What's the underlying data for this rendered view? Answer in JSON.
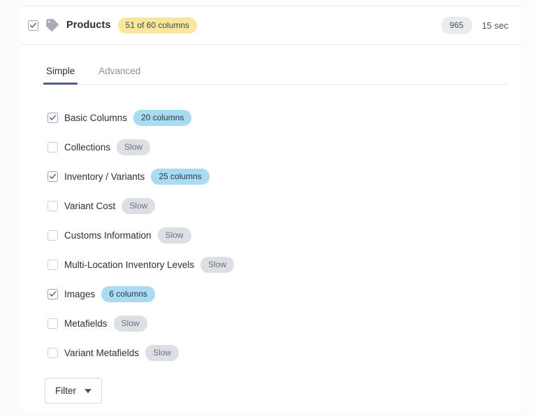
{
  "header": {
    "checkbox_checked": true,
    "icon": "tag-icon",
    "title": "Products",
    "columns_badge": "51 of 60 columns",
    "count_badge": "965",
    "duration": "15 sec"
  },
  "tabs": [
    {
      "label": "Simple",
      "active": true
    },
    {
      "label": "Advanced",
      "active": false
    }
  ],
  "options": [
    {
      "label": "Basic Columns",
      "checked": true,
      "badge": "20 columns",
      "badge_type": "blue"
    },
    {
      "label": "Collections",
      "checked": false,
      "badge": "Slow",
      "badge_type": "gray"
    },
    {
      "label": "Inventory / Variants",
      "checked": true,
      "badge": "25 columns",
      "badge_type": "blue"
    },
    {
      "label": "Variant Cost",
      "checked": false,
      "badge": "Slow",
      "badge_type": "gray"
    },
    {
      "label": "Customs Information",
      "checked": false,
      "badge": "Slow",
      "badge_type": "gray"
    },
    {
      "label": "Multi-Location Inventory Levels",
      "checked": false,
      "badge": "Slow",
      "badge_type": "gray"
    },
    {
      "label": "Images",
      "checked": true,
      "badge": "6 columns",
      "badge_type": "blue"
    },
    {
      "label": "Metafields",
      "checked": false,
      "badge": "Slow",
      "badge_type": "gray"
    },
    {
      "label": "Variant Metafields",
      "checked": false,
      "badge": "Slow",
      "badge_type": "gray"
    }
  ],
  "filter": {
    "label": "Filter",
    "caret_icon": "chevron-down-icon"
  },
  "colors": {
    "accent": "#4f5b93",
    "badge_yellow": "#f9e79f",
    "badge_blue": "#a9dcf3",
    "badge_gray": "#dcdfe4",
    "text": "#2a2f3a"
  }
}
